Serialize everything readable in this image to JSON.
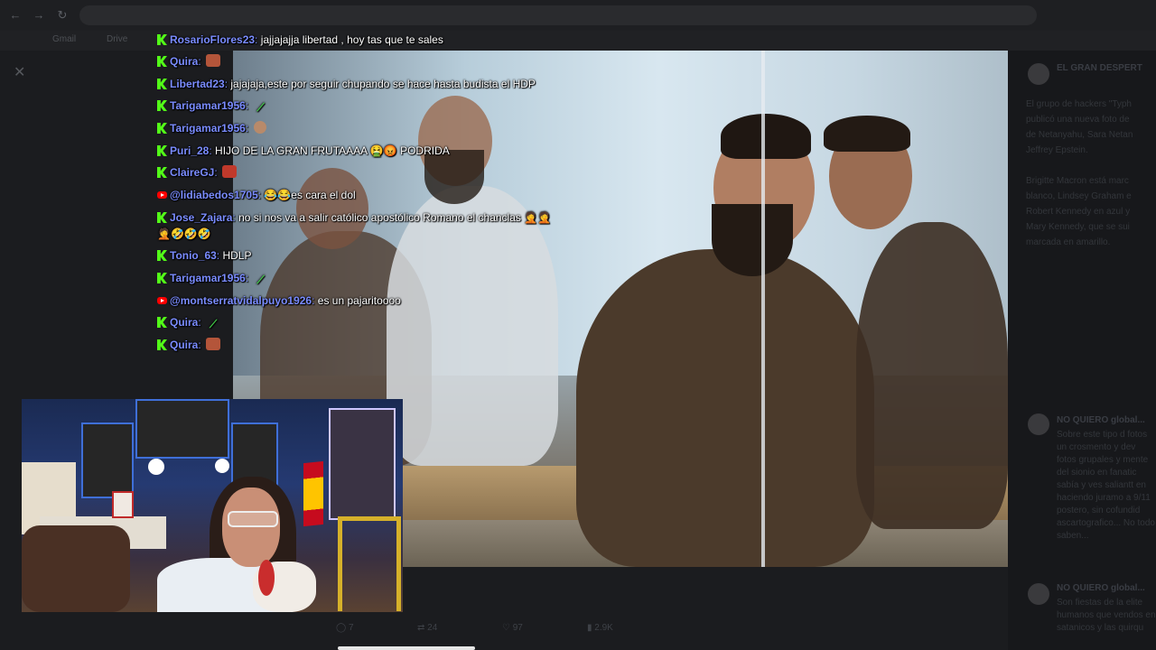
{
  "browser": {
    "url": "",
    "bookmarks": [
      "Gmail",
      "Drive"
    ]
  },
  "chat": [
    {
      "platform": "kick",
      "user": "RosarioFlores23",
      "text": "jajjajajja libertad , hoy tas que te sales",
      "emotes": []
    },
    {
      "platform": "kick",
      "user": "Quira",
      "text": "",
      "emotes": [
        "face"
      ]
    },
    {
      "platform": "kick",
      "user": "Libertad23",
      "text": "jajajaja,este por seguir chupando se hace hasta budista el HDP",
      "emotes": []
    },
    {
      "platform": "kick",
      "user": "Tarigamar1956",
      "text": "",
      "emotes": [
        "pickle"
      ]
    },
    {
      "platform": "kick",
      "user": "Tarigamar1956",
      "text": "",
      "emotes": [
        "tan"
      ]
    },
    {
      "platform": "kick",
      "user": "Puri_28",
      "text": "HIJO DE LA GRAN FRUTAAAA 🤮😡 PODRIDA",
      "emotes": []
    },
    {
      "platform": "kick",
      "user": "ClaireGJ",
      "text": "",
      "emotes": [
        "red"
      ]
    },
    {
      "platform": "youtube",
      "user": "@lidiabedos1705",
      "text": "😂😂es cara el dol",
      "emotes": []
    },
    {
      "platform": "kick",
      "user": "Jose_Zajara",
      "text": "no si nos va a salir católico apostólico Romano el chanclas 🤦🤦",
      "emotes": []
    },
    {
      "platform": "none",
      "user": "",
      "text": "🤦🤣🤣🤣",
      "emotes": []
    },
    {
      "platform": "kick",
      "user": "Tonio_63",
      "text": "HDLP",
      "emotes": []
    },
    {
      "platform": "kick",
      "user": "Tarigamar1956",
      "text": "",
      "emotes": [
        "pickle"
      ]
    },
    {
      "platform": "youtube",
      "user": "@montserratvidalpuyo1926",
      "text": "es un pajaritoooo",
      "emotes": []
    },
    {
      "platform": "kick",
      "user": "Quira",
      "text": "",
      "emotes": [
        "pickle"
      ]
    },
    {
      "platform": "kick",
      "user": "Quira",
      "text": "",
      "emotes": [
        "face"
      ]
    }
  ],
  "feed": {
    "author": "EL GRAN DESPERT",
    "post_lines": [
      "El grupo de hackers \"Typh",
      "publicó una nueva foto de",
      "de Netanyahu, Sara Netan",
      "Jeffrey Epstein.",
      "",
      "Brigitte Macron está marc",
      "blanco, Lindsey Graham e",
      "Robert Kennedy en azul y",
      "Mary Kennedy, que se sui",
      "marcada en amarillo."
    ],
    "replies": [
      {
        "name": "NO QUIERO global...",
        "lines": [
          "Sobre este tipo d fotos",
          "un crosmento y dev",
          "fotos grupales y mente",
          "del sionio en fanatic",
          "sabía y ves saliantt en",
          "haciendo juramo a 9/11",
          "postero, sin cofundid",
          "ascartografico... No todo",
          "saben..."
        ]
      },
      {
        "name": "NO QUIERO global...",
        "lines": [
          "Son fiestas de la elite",
          "humanos que vendos en",
          "satanicos y las quirqu"
        ]
      }
    ]
  },
  "stats": [
    "7",
    "24",
    "97",
    "2.9K"
  ],
  "colors": {
    "kick": "#53fc18",
    "youtube": "#ff0000",
    "username": "#7a8cff"
  },
  "icons": [
    "kick-badge-icon",
    "youtube-badge-icon",
    "close-icon",
    "reply-icon",
    "retweet-icon",
    "like-icon",
    "views-icon"
  ]
}
